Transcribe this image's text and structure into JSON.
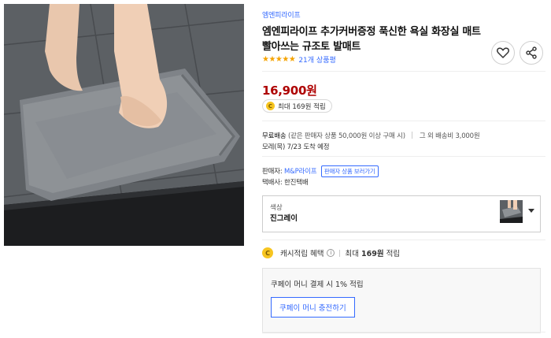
{
  "product": {
    "brand": "엠엔피라이프",
    "title": "엠엔피라이프 추가커버증정 푹신한 욕실 화장실 매트 빨아쓰는 규조토 발매트",
    "stars": "★★★★★",
    "rating_value": 5,
    "review_count": "21개 상품평",
    "price": "16,900원",
    "reward_chip": "최대 169원 적립",
    "coin_symbol": "C"
  },
  "shipping": {
    "free_label": "무료배송",
    "free_condition": "(같은 판매자 상품 50,000원 이상 구매 시)",
    "other_fee": "그 외 배송비 3,000원",
    "arrival": "모레(목) 7/23 도착 예정"
  },
  "seller": {
    "label": "판매자:",
    "name": "M&P라이프",
    "more_link": "판매자 상품 보러가기",
    "courier_label": "택배사:",
    "courier": "한진택배"
  },
  "option": {
    "name": "색상",
    "value": "진그레이"
  },
  "cash": {
    "label": "캐시적립 혜택",
    "info": "i",
    "max_prefix": "최대",
    "max_amount": "169원",
    "max_suffix": "적립"
  },
  "coupay": {
    "text": "쿠페이 머니 결제 시 1% 적립",
    "button": "쿠페이 머니 충전하기"
  },
  "colors": {
    "link": "#346aff",
    "price": "#ae0000",
    "star": "#f5a300",
    "coin": "#f7c520"
  }
}
